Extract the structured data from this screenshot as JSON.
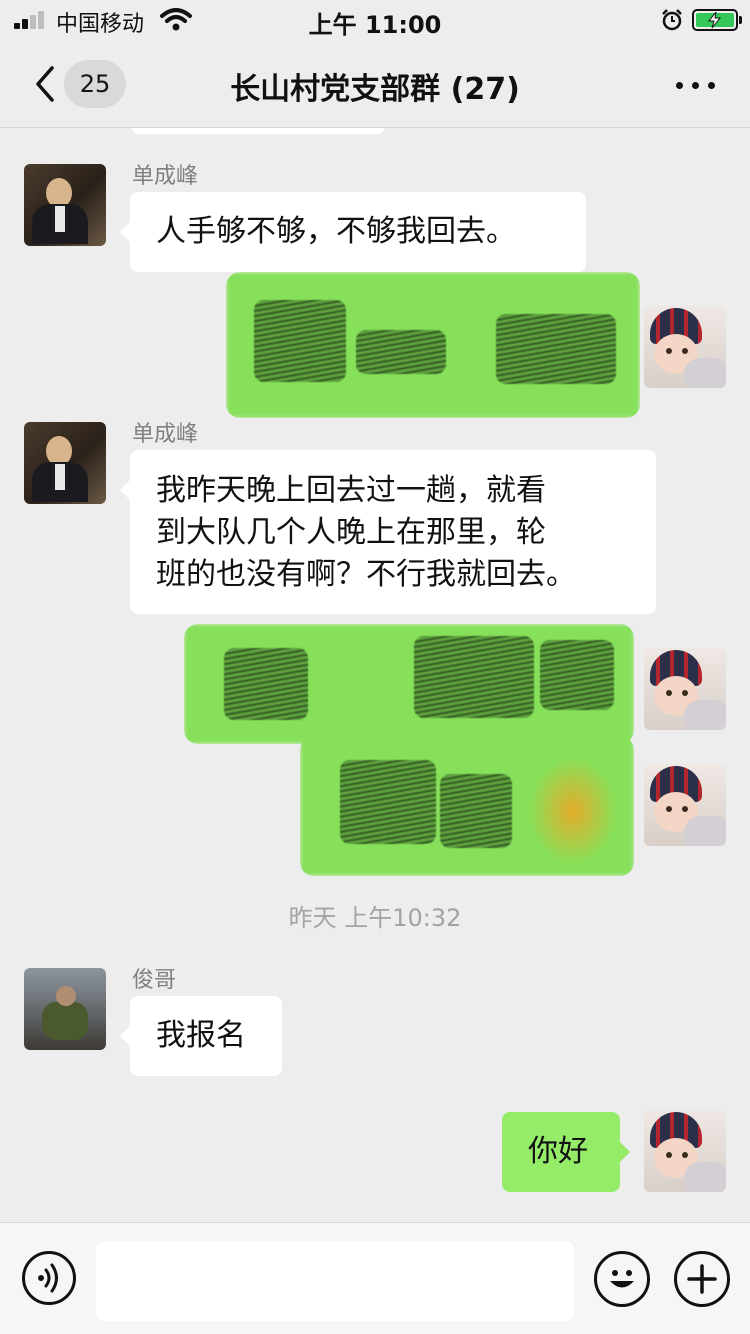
{
  "status_bar": {
    "carrier": "中国移动",
    "time": "上午 11:00",
    "battery_state": "charging"
  },
  "header": {
    "unread_count": "25",
    "title": "长山村党支部群 (27)"
  },
  "messages": [
    {
      "sender": "单成峰",
      "side": "left",
      "text": "人手够不够，不够我回去。"
    },
    {
      "side": "right",
      "redacted": true
    },
    {
      "sender": "单成峰",
      "side": "left",
      "lines": [
        "我昨天晚上回去过一趟，就看",
        "到大队几个人晚上在那里，轮",
        "班的也没有啊？不行我就回去。"
      ]
    },
    {
      "side": "right",
      "redacted": true
    },
    {
      "side": "right",
      "redacted": true
    },
    {
      "timestamp": "昨天 上午10:32"
    },
    {
      "sender": "俊哥",
      "side": "left",
      "text": "我报名"
    },
    {
      "side": "right",
      "text": "你好"
    }
  ],
  "input_bar": {
    "placeholder": "",
    "icons": [
      "voice-icon",
      "emoji-icon",
      "plus-icon"
    ]
  },
  "colors": {
    "background": "#ededed",
    "outgoing_bubble": "#95ec69",
    "incoming_bubble": "#ffffff",
    "meta_text": "#a3a3a3"
  }
}
